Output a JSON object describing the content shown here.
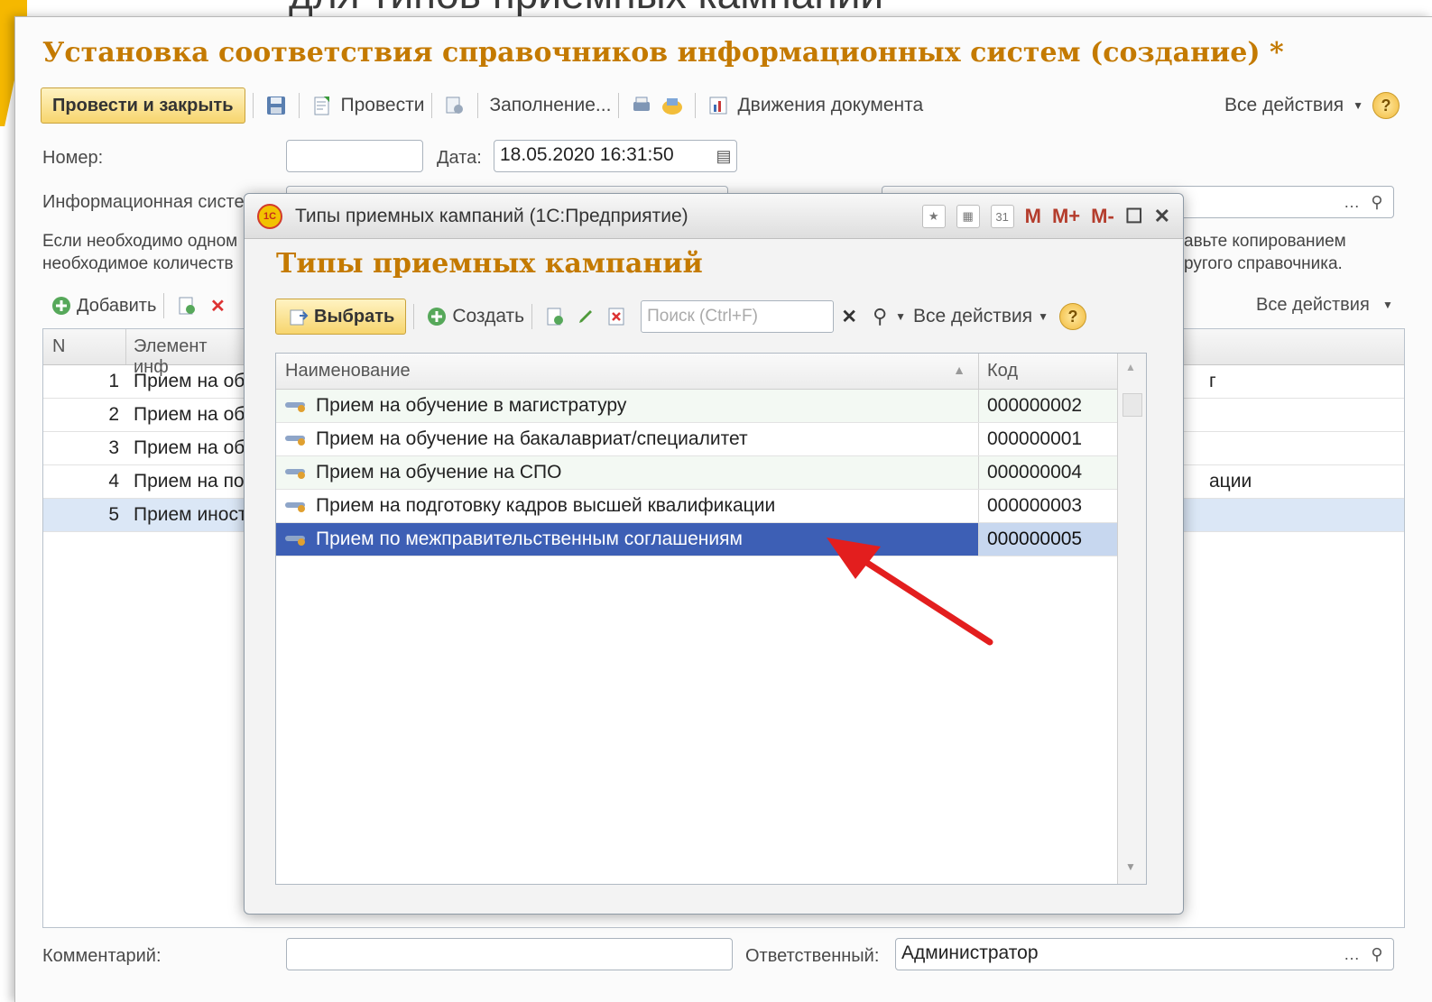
{
  "slide": {
    "title": "для типов приемных кампаний"
  },
  "document": {
    "title": "Установка соответствия справочников информационных систем (создание) *",
    "toolbar": {
      "post_close": "Провести и закрыть",
      "post": "Провести",
      "fill": "Заполнение...",
      "movements": "Движения документа",
      "all_actions": "Все действия",
      "help": "?"
    },
    "number_label": "Номер:",
    "number_value": "",
    "date_label": "Дата:",
    "date_value": "18.05.2020 16:31:50",
    "info_system_label": "Информационная систе",
    "description_left": "Если необходимо одном\nнеобходимое количеств",
    "description_right": "авьте копированием\nругого справочника.",
    "tab": {
      "add": "Добавить",
      "all_actions": "Все действия"
    },
    "table": {
      "col_n": "N",
      "col_element": "Элемент инф",
      "rows": [
        {
          "n": "1",
          "text": "Прием на об",
          "right": "г"
        },
        {
          "n": "2",
          "text": "Прием на об",
          "right": ""
        },
        {
          "n": "3",
          "text": "Прием на об",
          "right": ""
        },
        {
          "n": "4",
          "text": "Прием на по",
          "right": "ации"
        },
        {
          "n": "5",
          "text": "Прием иност",
          "right": ""
        }
      ]
    },
    "comment_label": "Комментарий:",
    "comment_value": "",
    "responsible_label": "Ответственный:",
    "responsible_value": "Администратор"
  },
  "modal": {
    "window_title": "Типы приемных кампаний  (1С:Предприятие)",
    "calc_tools": {
      "m": "M",
      "m_plus": "M+",
      "m_minus": "M-"
    },
    "heading": "Типы приемных кампаний",
    "toolbar": {
      "select": "Выбрать",
      "create": "Создать",
      "search_placeholder": "Поиск (Ctrl+F)",
      "all_actions": "Все действия",
      "help": "?"
    },
    "columns": {
      "name": "Наименование",
      "code": "Код"
    },
    "rows": [
      {
        "name": "Прием на обучение в магистратуру",
        "code": "000000002"
      },
      {
        "name": "Прием на обучение на бакалавриат/специалитет",
        "code": "000000001"
      },
      {
        "name": "Прием на обучение на СПО",
        "code": "000000004"
      },
      {
        "name": "Прием на подготовку кадров высшей квалификации",
        "code": "000000003"
      },
      {
        "name": "Прием по межправительственным соглашениям",
        "code": "000000005"
      }
    ],
    "selected_index": 4
  },
  "colors": {
    "accent": "#c47a00",
    "selection": "#3d5fb5",
    "annotation_arrow": "#e31e1e"
  }
}
